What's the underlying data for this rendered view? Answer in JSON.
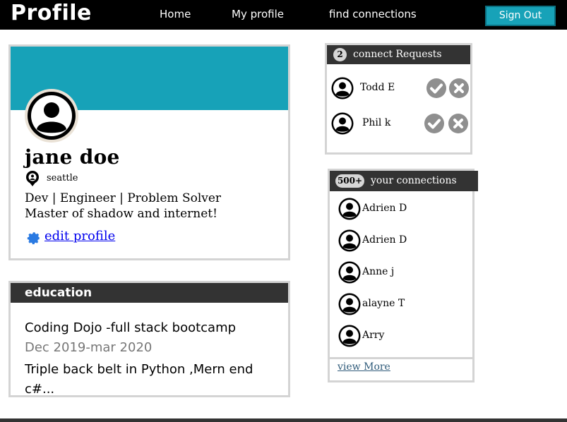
{
  "navbar": {
    "brand": "Profile",
    "links": [
      {
        "label": "Home"
      },
      {
        "label": "My profile"
      },
      {
        "label": "find connections"
      }
    ],
    "signout_label": "Sign Out"
  },
  "profile": {
    "name": "jane doe",
    "location": "seattle",
    "headline": "Dev | Engineer | Problem Solver",
    "bio": "Master of shadow and internet!",
    "edit_label": "edit profile",
    "cover_color": "#17a2b8"
  },
  "education": {
    "header": "education",
    "school": "Coding Dojo -full stack bootcamp",
    "dates": "Dec 2019-mar 2020",
    "description": "Triple back belt in Python ,Mern end c#..."
  },
  "requests": {
    "count": "2",
    "title": "connect Requests",
    "items": [
      {
        "name": "Todd E"
      },
      {
        "name": "Phil k"
      }
    ]
  },
  "connections": {
    "count": "500+",
    "title": "your connections",
    "items": [
      {
        "name": "Adrien D"
      },
      {
        "name": "Adrien D"
      },
      {
        "name": "Anne j"
      },
      {
        "name": "alayne T"
      },
      {
        "name": "Arry"
      }
    ],
    "view_more_label": "view More"
  },
  "colors": {
    "accent": "#17a2b8",
    "navbar": "#000000",
    "header_dark": "#333333",
    "card_border": "#d4d4d4"
  },
  "icons": [
    "user-avatar-icon",
    "location-pin-icon",
    "gear-icon",
    "check-circle-icon",
    "x-circle-icon"
  ]
}
